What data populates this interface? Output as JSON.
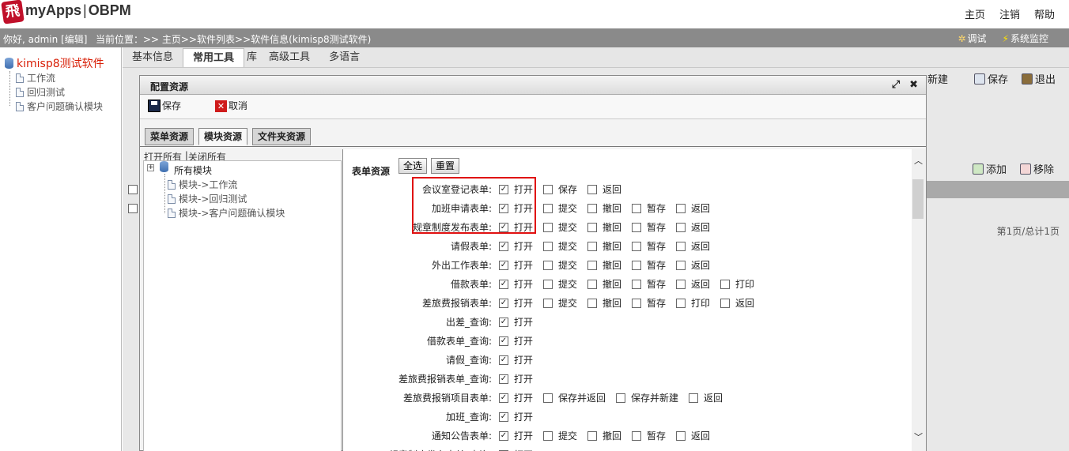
{
  "header": {
    "logo_text": "myApps",
    "separator": "|",
    "product": "OBPM",
    "links": [
      "主页",
      "注销",
      "帮助"
    ]
  },
  "infobar": {
    "greeting": "你好, admin [编辑]",
    "location": "当前位置：>> 主页>>软件列表>>软件信息(kimisp8测试软件)",
    "debug": "调试",
    "monitor": "系统监控"
  },
  "left_tree": {
    "root": "kimisp8测试软件",
    "items": [
      "工作流",
      "回归测试",
      "客户问题确认模块"
    ]
  },
  "tabs": [
    "基本信息",
    "常用工具",
    "库",
    "高级工具",
    "多语言"
  ],
  "right_tools": {
    "new": "新建",
    "save": "保存",
    "exit": "退出",
    "add": "添加",
    "remove": "移除"
  },
  "pager": "第1页/总计1页",
  "dialog": {
    "title": "配置资源",
    "save": "保存",
    "cancel": "取消",
    "resource_tabs": [
      "菜单资源",
      "模块资源",
      "文件夹资源"
    ],
    "open_all": "打开所有",
    "close_all": "关闭所有",
    "module_tree": {
      "root": "所有模块",
      "items": [
        "模块->工作流",
        "模块->回归测试",
        "模块->客户问题确认模块"
      ]
    },
    "form_resource_label": "表单资源",
    "select_all": "全选",
    "reset": "重置",
    "forms": [
      {
        "label": "会议室登记表单:",
        "opts": [
          [
            "打开",
            true
          ],
          [
            "保存",
            false
          ],
          [
            "返回",
            false
          ]
        ]
      },
      {
        "label": "加班申请表单:",
        "opts": [
          [
            "打开",
            true
          ],
          [
            "提交",
            false
          ],
          [
            "撤回",
            false
          ],
          [
            "暂存",
            false
          ],
          [
            "返回",
            false
          ]
        ]
      },
      {
        "label": "规章制度发布表单:",
        "opts": [
          [
            "打开",
            true
          ],
          [
            "提交",
            false
          ],
          [
            "撤回",
            false
          ],
          [
            "暂存",
            false
          ],
          [
            "返回",
            false
          ]
        ]
      },
      {
        "label": "请假表单:",
        "opts": [
          [
            "打开",
            true
          ],
          [
            "提交",
            false
          ],
          [
            "撤回",
            false
          ],
          [
            "暂存",
            false
          ],
          [
            "返回",
            false
          ]
        ]
      },
      {
        "label": "外出工作表单:",
        "opts": [
          [
            "打开",
            true
          ],
          [
            "提交",
            false
          ],
          [
            "撤回",
            false
          ],
          [
            "暂存",
            false
          ],
          [
            "返回",
            false
          ]
        ]
      },
      {
        "label": "借款表单:",
        "opts": [
          [
            "打开",
            true
          ],
          [
            "提交",
            false
          ],
          [
            "撤回",
            false
          ],
          [
            "暂存",
            false
          ],
          [
            "返回",
            false
          ],
          [
            "打印",
            false
          ]
        ]
      },
      {
        "label": "差旅费报销表单:",
        "opts": [
          [
            "打开",
            true
          ],
          [
            "提交",
            false
          ],
          [
            "撤回",
            false
          ],
          [
            "暂存",
            false
          ],
          [
            "打印",
            false
          ],
          [
            "返回",
            false
          ]
        ]
      },
      {
        "label": "出差_查询:",
        "opts": [
          [
            "打开",
            true
          ]
        ]
      },
      {
        "label": "借款表单_查询:",
        "opts": [
          [
            "打开",
            true
          ]
        ]
      },
      {
        "label": "请假_查询:",
        "opts": [
          [
            "打开",
            true
          ]
        ]
      },
      {
        "label": "差旅费报销表单_查询:",
        "opts": [
          [
            "打开",
            true
          ]
        ]
      },
      {
        "label": "差旅费报销项目表单:",
        "opts": [
          [
            "打开",
            true
          ],
          [
            "保存并返回",
            false
          ],
          [
            "保存并新建",
            false
          ],
          [
            "返回",
            false
          ]
        ]
      },
      {
        "label": "加班_查询:",
        "opts": [
          [
            "打开",
            true
          ]
        ]
      },
      {
        "label": "通知公告表单:",
        "opts": [
          [
            "打开",
            true
          ],
          [
            "提交",
            false
          ],
          [
            "撤回",
            false
          ],
          [
            "暂存",
            false
          ],
          [
            "返回",
            false
          ]
        ]
      },
      {
        "label": "规章制度发布表单_查询:",
        "opts": [
          [
            "打开",
            true
          ]
        ]
      }
    ]
  }
}
